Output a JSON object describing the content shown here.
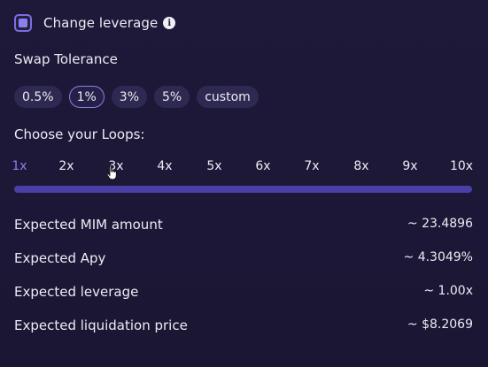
{
  "leverage": {
    "label": "Change leverage",
    "checked": true,
    "info_icon": "info-icon",
    "info_glyph": "i"
  },
  "swap_tolerance": {
    "title": "Swap Tolerance",
    "options": [
      "0.5%",
      "1%",
      "3%",
      "5%",
      "custom"
    ],
    "selected": "1%"
  },
  "loops": {
    "title": "Choose your Loops:",
    "options": [
      "1x",
      "2x",
      "3x",
      "4x",
      "5x",
      "6x",
      "7x",
      "8x",
      "9x",
      "10x"
    ],
    "selected": "1x"
  },
  "results": [
    {
      "label": "Expected MIM amount",
      "value": "~ 23.4896"
    },
    {
      "label": "Expected Apy",
      "value": "~ 4.3049%"
    },
    {
      "label": "Expected leverage",
      "value": "~ 1.00x"
    },
    {
      "label": "Expected liquidation price",
      "value": "~ $8.2069"
    }
  ],
  "colors": {
    "background": "#1d1838",
    "accent": "#7a6ee0",
    "track": "#4a3fa6",
    "chip": "#2e2950",
    "text": "#ecebf4"
  }
}
